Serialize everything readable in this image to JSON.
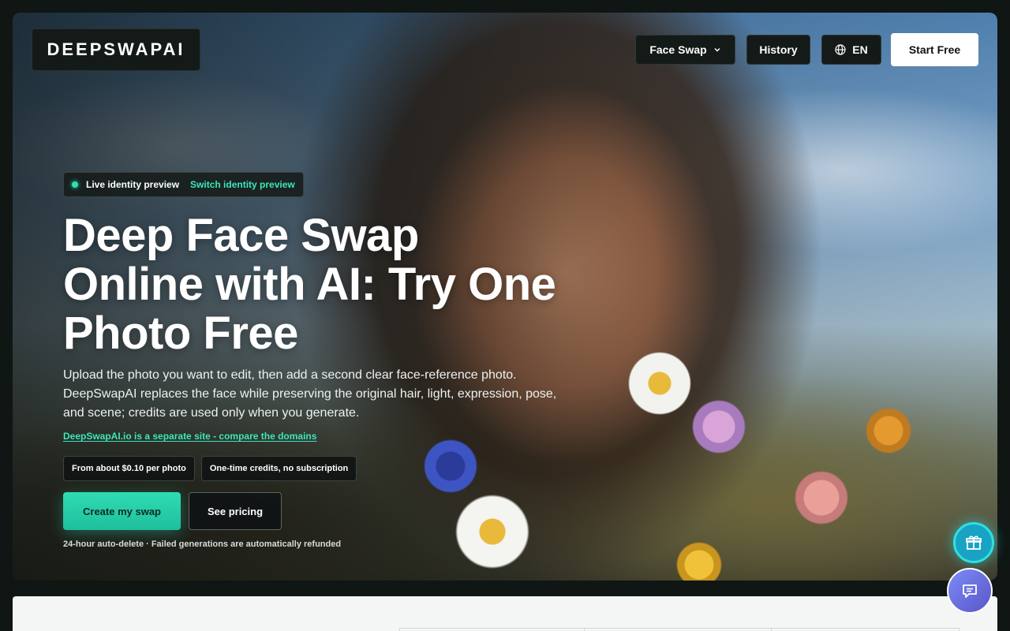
{
  "header": {
    "logo": "DEEPSWAPAI",
    "nav": {
      "face_swap": "Face Swap",
      "history": "History",
      "language": "EN",
      "start_free": "Start Free"
    }
  },
  "hero": {
    "badge_status": "Live identity preview",
    "badge_switch": "Switch identity preview",
    "title_line1": "Deep Face Swap",
    "title_line2": "Online with AI: Try One",
    "title_line3": "Photo Free",
    "description": "Upload the photo you want to edit, then add a second clear face-reference photo. DeepSwapAI replaces the face while preserving the original hair, light, expression, pose, and scene; credits are used only when you generate.",
    "domain_link": "DeepSwapAI.io is a separate site - compare the domains",
    "chips": [
      "From about $0.10 per photo",
      "One-time credits, no subscription"
    ],
    "cta_primary": "Create my swap",
    "cta_secondary": "See pricing",
    "note": "24-hour auto-delete · Failed generations are automatically refunded"
  },
  "icons": {
    "nav_dropdown": "chevron-down-icon",
    "language": "globe-icon",
    "status": "status-dot-icon",
    "floating_gift": "gift-icon",
    "floating_chat": "chat-icon"
  },
  "colors": {
    "accent": "#2ee0b0",
    "page_background": "#0f1614",
    "chat_button": "#6b6fe0"
  }
}
